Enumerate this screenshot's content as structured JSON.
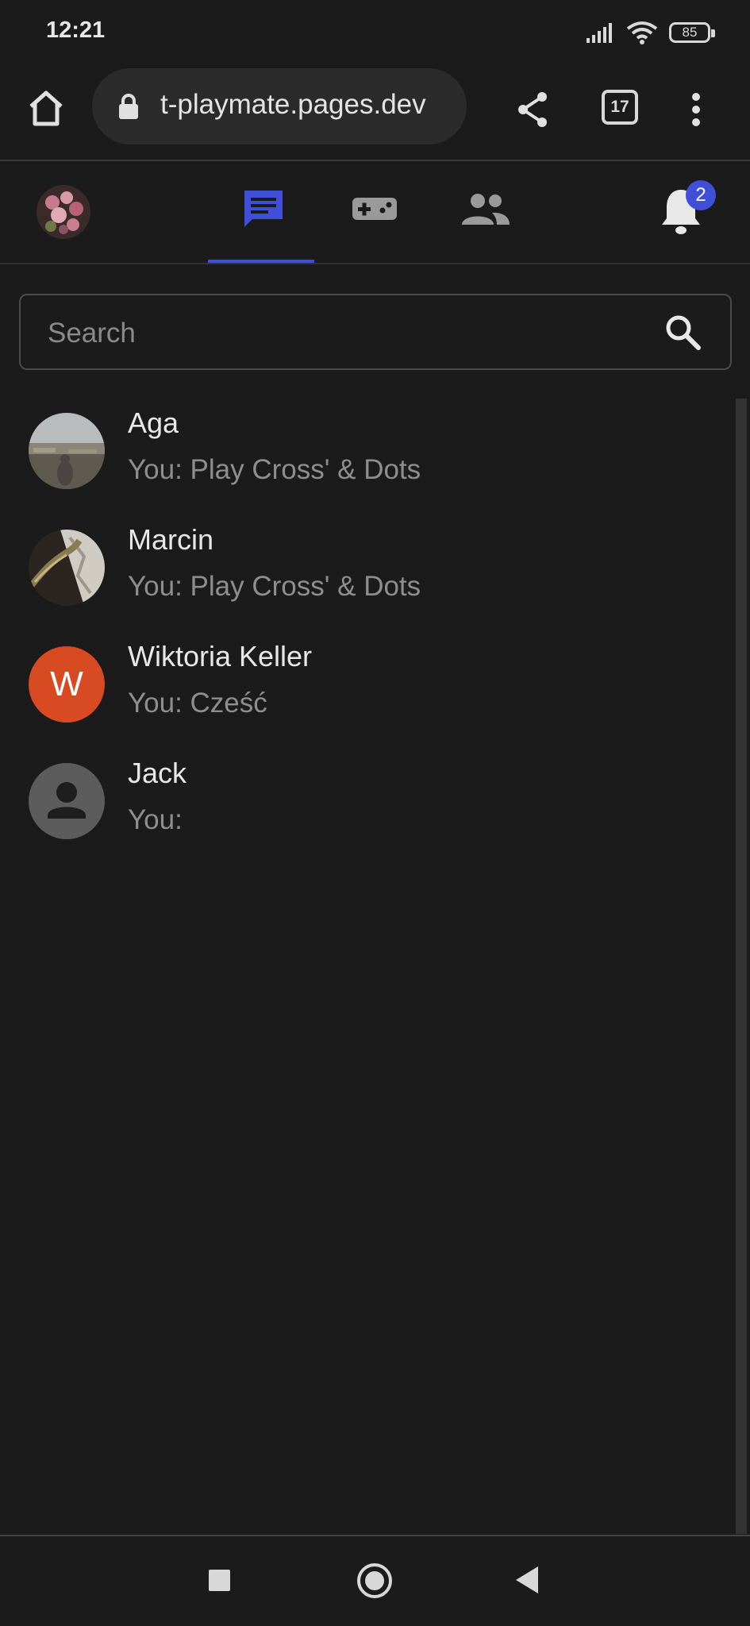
{
  "status_bar": {
    "time": "12:21",
    "battery": "85"
  },
  "browser": {
    "url": "t-playmate.pages.dev",
    "tab_count": "17"
  },
  "app_nav": {
    "tabs": [
      {
        "id": "chats",
        "icon": "chat-icon",
        "active": true
      },
      {
        "id": "games",
        "icon": "gamepad-icon",
        "active": false
      },
      {
        "id": "friends",
        "icon": "people-icon",
        "active": false
      }
    ],
    "notification_count": "2",
    "accent_color": "#3f4fd8"
  },
  "search": {
    "placeholder": "Search",
    "value": ""
  },
  "conversations": [
    {
      "name": "Aga",
      "preview": "You: Play Cross' & Dots",
      "avatar": "photo"
    },
    {
      "name": "Marcin",
      "preview": "You: Play Cross' & Dots",
      "avatar": "photo"
    },
    {
      "name": "Wiktoria Keller",
      "preview": "You: Cześć",
      "avatar": "initial",
      "initial": "W",
      "avatar_color": "#d84a22"
    },
    {
      "name": "Jack",
      "preview": "You:",
      "avatar": "default-person"
    }
  ]
}
